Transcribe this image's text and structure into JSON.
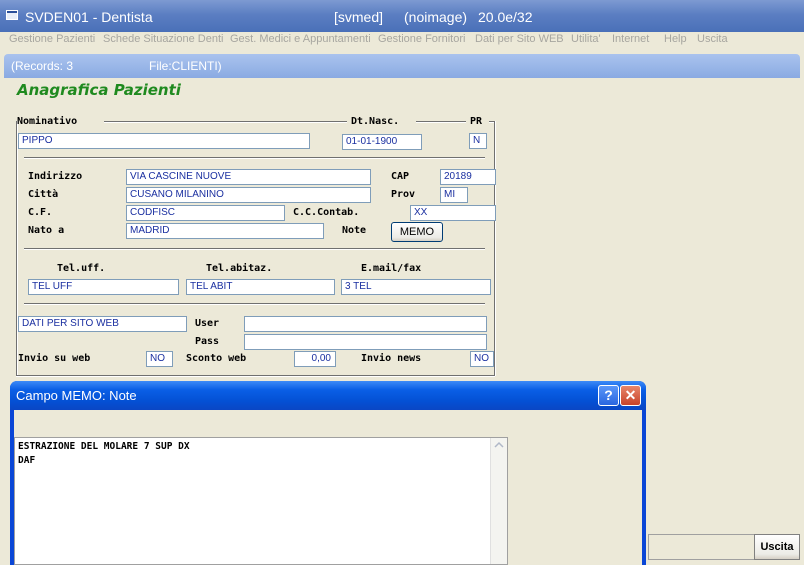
{
  "window": {
    "app_title": "SVDEN01 - Dentista",
    "db": "[svmed]",
    "image_mode": "(noimage)",
    "version": "20.0e/32"
  },
  "menu": [
    "Gestione Pazienti",
    "Schede Situazione Denti",
    "Gest. Medici e Appuntamenti",
    "Gestione Fornitori",
    "Dati per Sito WEB",
    "Utilita'",
    "Internet",
    "Help",
    "Uscita"
  ],
  "status": {
    "records": "(Records: 3",
    "file": "File:CLIENTI)"
  },
  "form": {
    "title": "Anagrafica Pazienti",
    "labels": {
      "nominativo": "Nominativo",
      "dt_nasc": "Dt.Nasc.",
      "pr": "PR",
      "indirizzo": "Indirizzo",
      "cap": "CAP",
      "citta": "Città",
      "prov": "Prov",
      "cf": "C.F.",
      "cc_contab": "C.C.Contab.",
      "nato_a": "Nato a",
      "note": "Note",
      "tel_uff": "Tel.uff.",
      "tel_abitaz": "Tel.abitaz.",
      "email_fax": "E.mail/fax",
      "user": "User",
      "pass": "Pass",
      "invio_web": "Invio su web",
      "sconto_web": "Sconto web",
      "invio_news": "Invio news"
    },
    "values": {
      "nominativo": "PIPPO",
      "dt_nasc": "01-01-1900",
      "pr": "N",
      "indirizzo": "VIA CASCINE NUOVE",
      "cap": "20189",
      "citta": "CUSANO MILANINO",
      "prov": "MI",
      "cf": "CODFISC",
      "cc_contab": "XX",
      "nato_a": "MADRID",
      "tel_uff": "TEL UFF",
      "tel_abitaz": "TEL ABIT",
      "email_fax": "3 TEL",
      "dati_sito_web": "DATI PER SITO WEB",
      "user": "",
      "pass": "",
      "invio_web": "NO",
      "sconto_web": "0,00",
      "invio_news": "NO"
    },
    "memo_button": "MEMO",
    "uscita_button": "Uscita"
  },
  "dialog": {
    "title": "Campo MEMO: Note",
    "help_symbol": "?",
    "close_symbol": "✕",
    "memo_lines": [
      "ESTRAZIONE DEL MOLARE 7 SUP DX",
      "DAF"
    ]
  },
  "colors": {
    "form_title": "#1f8a1f",
    "field_text": "#1a2fa0",
    "dialog_title_bar": "#0450d4",
    "close_button": "#c8432a"
  }
}
